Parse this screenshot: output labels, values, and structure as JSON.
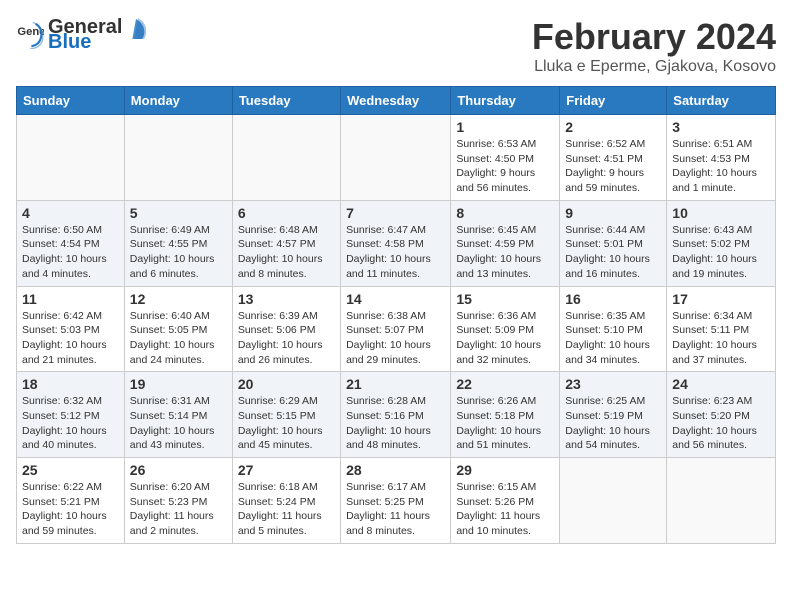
{
  "header": {
    "logo_general": "General",
    "logo_blue": "Blue",
    "month_title": "February 2024",
    "location": "Lluka e Eperme, Gjakova, Kosovo"
  },
  "days_of_week": [
    "Sunday",
    "Monday",
    "Tuesday",
    "Wednesday",
    "Thursday",
    "Friday",
    "Saturday"
  ],
  "weeks": [
    [
      {
        "day": "",
        "info": ""
      },
      {
        "day": "",
        "info": ""
      },
      {
        "day": "",
        "info": ""
      },
      {
        "day": "",
        "info": ""
      },
      {
        "day": "1",
        "info": "Sunrise: 6:53 AM\nSunset: 4:50 PM\nDaylight: 9 hours and 56 minutes."
      },
      {
        "day": "2",
        "info": "Sunrise: 6:52 AM\nSunset: 4:51 PM\nDaylight: 9 hours and 59 minutes."
      },
      {
        "day": "3",
        "info": "Sunrise: 6:51 AM\nSunset: 4:53 PM\nDaylight: 10 hours and 1 minute."
      }
    ],
    [
      {
        "day": "4",
        "info": "Sunrise: 6:50 AM\nSunset: 4:54 PM\nDaylight: 10 hours and 4 minutes."
      },
      {
        "day": "5",
        "info": "Sunrise: 6:49 AM\nSunset: 4:55 PM\nDaylight: 10 hours and 6 minutes."
      },
      {
        "day": "6",
        "info": "Sunrise: 6:48 AM\nSunset: 4:57 PM\nDaylight: 10 hours and 8 minutes."
      },
      {
        "day": "7",
        "info": "Sunrise: 6:47 AM\nSunset: 4:58 PM\nDaylight: 10 hours and 11 minutes."
      },
      {
        "day": "8",
        "info": "Sunrise: 6:45 AM\nSunset: 4:59 PM\nDaylight: 10 hours and 13 minutes."
      },
      {
        "day": "9",
        "info": "Sunrise: 6:44 AM\nSunset: 5:01 PM\nDaylight: 10 hours and 16 minutes."
      },
      {
        "day": "10",
        "info": "Sunrise: 6:43 AM\nSunset: 5:02 PM\nDaylight: 10 hours and 19 minutes."
      }
    ],
    [
      {
        "day": "11",
        "info": "Sunrise: 6:42 AM\nSunset: 5:03 PM\nDaylight: 10 hours and 21 minutes."
      },
      {
        "day": "12",
        "info": "Sunrise: 6:40 AM\nSunset: 5:05 PM\nDaylight: 10 hours and 24 minutes."
      },
      {
        "day": "13",
        "info": "Sunrise: 6:39 AM\nSunset: 5:06 PM\nDaylight: 10 hours and 26 minutes."
      },
      {
        "day": "14",
        "info": "Sunrise: 6:38 AM\nSunset: 5:07 PM\nDaylight: 10 hours and 29 minutes."
      },
      {
        "day": "15",
        "info": "Sunrise: 6:36 AM\nSunset: 5:09 PM\nDaylight: 10 hours and 32 minutes."
      },
      {
        "day": "16",
        "info": "Sunrise: 6:35 AM\nSunset: 5:10 PM\nDaylight: 10 hours and 34 minutes."
      },
      {
        "day": "17",
        "info": "Sunrise: 6:34 AM\nSunset: 5:11 PM\nDaylight: 10 hours and 37 minutes."
      }
    ],
    [
      {
        "day": "18",
        "info": "Sunrise: 6:32 AM\nSunset: 5:12 PM\nDaylight: 10 hours and 40 minutes."
      },
      {
        "day": "19",
        "info": "Sunrise: 6:31 AM\nSunset: 5:14 PM\nDaylight: 10 hours and 43 minutes."
      },
      {
        "day": "20",
        "info": "Sunrise: 6:29 AM\nSunset: 5:15 PM\nDaylight: 10 hours and 45 minutes."
      },
      {
        "day": "21",
        "info": "Sunrise: 6:28 AM\nSunset: 5:16 PM\nDaylight: 10 hours and 48 minutes."
      },
      {
        "day": "22",
        "info": "Sunrise: 6:26 AM\nSunset: 5:18 PM\nDaylight: 10 hours and 51 minutes."
      },
      {
        "day": "23",
        "info": "Sunrise: 6:25 AM\nSunset: 5:19 PM\nDaylight: 10 hours and 54 minutes."
      },
      {
        "day": "24",
        "info": "Sunrise: 6:23 AM\nSunset: 5:20 PM\nDaylight: 10 hours and 56 minutes."
      }
    ],
    [
      {
        "day": "25",
        "info": "Sunrise: 6:22 AM\nSunset: 5:21 PM\nDaylight: 10 hours and 59 minutes."
      },
      {
        "day": "26",
        "info": "Sunrise: 6:20 AM\nSunset: 5:23 PM\nDaylight: 11 hours and 2 minutes."
      },
      {
        "day": "27",
        "info": "Sunrise: 6:18 AM\nSunset: 5:24 PM\nDaylight: 11 hours and 5 minutes."
      },
      {
        "day": "28",
        "info": "Sunrise: 6:17 AM\nSunset: 5:25 PM\nDaylight: 11 hours and 8 minutes."
      },
      {
        "day": "29",
        "info": "Sunrise: 6:15 AM\nSunset: 5:26 PM\nDaylight: 11 hours and 10 minutes."
      },
      {
        "day": "",
        "info": ""
      },
      {
        "day": "",
        "info": ""
      }
    ]
  ]
}
